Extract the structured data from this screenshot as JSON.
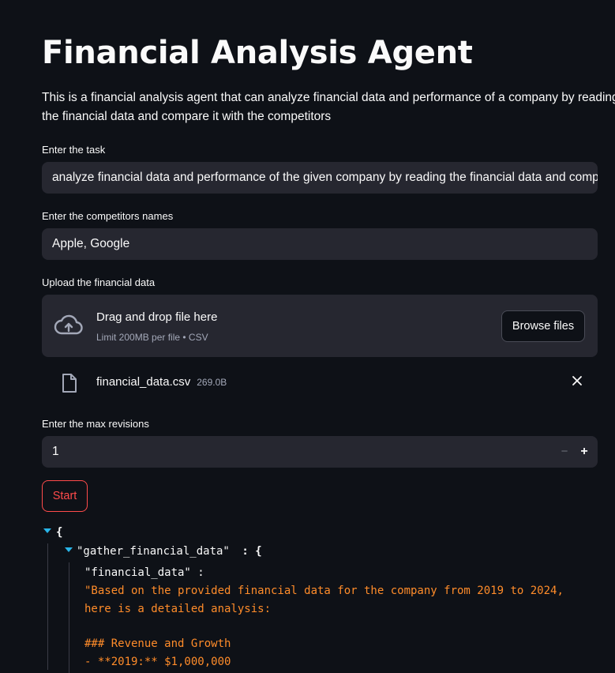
{
  "page": {
    "title": "Financial Analysis Agent",
    "description": "This is a financial analysis agent that can analyze financial data and performance of a company by reading the financial data and compare it with the competitors"
  },
  "form": {
    "task": {
      "label": "Enter the task",
      "value": "analyze financial data and performance of the given company by reading the financial data and compare it with the competitors"
    },
    "competitors": {
      "label": "Enter the competitors names",
      "value": "Apple, Google"
    },
    "upload": {
      "label": "Upload the financial data",
      "drop_title": "Drag and drop file here",
      "drop_subtitle": "Limit 200MB per file • CSV",
      "browse_label": "Browse files",
      "file": {
        "name": "financial_data.csv",
        "size": "269.0B"
      }
    },
    "max_revisions": {
      "label": "Enter the max revisions",
      "value": "1",
      "minus": "−",
      "plus": "+"
    },
    "start_label": "Start"
  },
  "output": {
    "open_brace": "{",
    "key1": "\"gather_financial_data\"",
    "key1_suffix": " : {",
    "key2": "\"financial_data\" :",
    "lines": [
      "\"Based on the provided financial data for the company from 2019 to 2024,",
      "here is a detailed analysis:",
      "",
      "### Revenue and Growth",
      "- **2019:** $1,000,000"
    ]
  },
  "colors": {
    "background": "#0e1117",
    "input_bg": "#262730",
    "accent_red": "#ff4b4b",
    "json_string": "#ff8c2a",
    "json_toggle": "#29b5e8"
  },
  "icons": [
    "cloud-upload-icon",
    "file-icon",
    "close-icon",
    "caret-down-icon"
  ]
}
